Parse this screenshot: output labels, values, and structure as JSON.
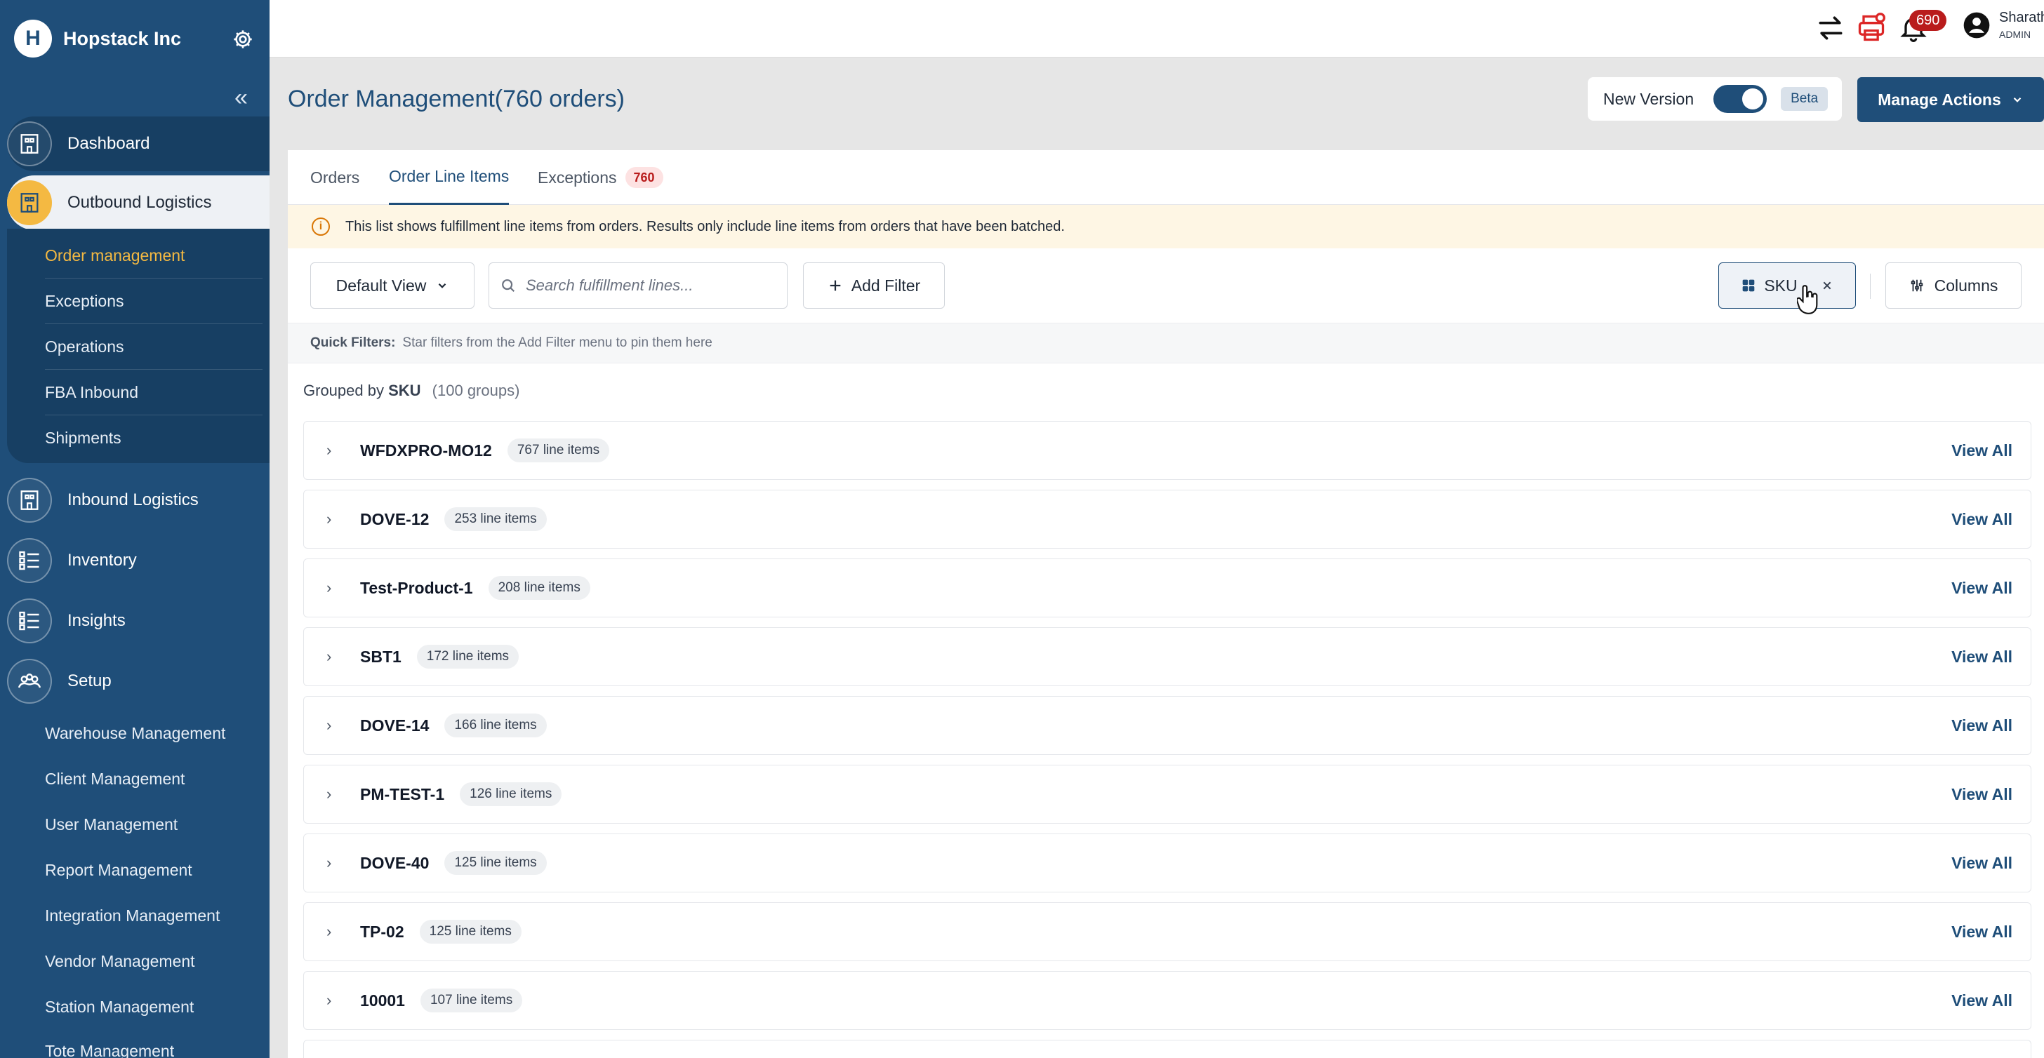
{
  "brand": {
    "name": "Hopstack Inc",
    "logo_letter": "H"
  },
  "sidebar": {
    "collapse_glyph": "«",
    "nav": [
      {
        "label": "Dashboard"
      },
      {
        "label": "Outbound Logistics"
      },
      {
        "label": "Inbound Logistics"
      },
      {
        "label": "Inventory"
      },
      {
        "label": "Insights"
      },
      {
        "label": "Setup"
      }
    ],
    "outbound_sub": [
      "Order management",
      "Exceptions",
      "Operations",
      "FBA Inbound",
      "Shipments"
    ],
    "setup_sub": [
      "Warehouse Management",
      "Client Management",
      "User Management",
      "Report Management",
      "Integration Management",
      "Vendor Management",
      "Station Management",
      "Tote Management"
    ]
  },
  "topbar": {
    "notification_count": "690",
    "user_name": "Sharath",
    "user_role": "ADMIN"
  },
  "header": {
    "title": "Order Management(760 orders)",
    "new_version_label": "New Version",
    "beta_label": "Beta",
    "manage_actions_label": "Manage Actions"
  },
  "tabs": [
    {
      "label": "Orders"
    },
    {
      "label": "Order Line Items"
    },
    {
      "label": "Exceptions",
      "count": "760"
    }
  ],
  "banner": {
    "icon": "i",
    "text": "This list shows fulfillment line items from orders. Results only include line items from orders that have been batched."
  },
  "toolbar": {
    "default_view_label": "Default View",
    "search_placeholder": "Search fulfillment lines...",
    "add_filter_label": "Add Filter",
    "sku_chip_label": "SKU",
    "columns_label": "Columns"
  },
  "quick_filters": {
    "label": "Quick Filters:",
    "hint": "Star filters from the Add Filter menu to pin them here"
  },
  "grouping": {
    "label": "Grouped by",
    "field": "SKU",
    "groups_text": "(100 groups)"
  },
  "groups": [
    {
      "sku": "WFDXPRO-MO12",
      "count": "767 line items"
    },
    {
      "sku": "DOVE-12",
      "count": "253 line items"
    },
    {
      "sku": "Test-Product-1",
      "count": "208 line items"
    },
    {
      "sku": "SBT1",
      "count": "172 line items"
    },
    {
      "sku": "DOVE-14",
      "count": "166 line items"
    },
    {
      "sku": "PM-TEST-1",
      "count": "126 line items"
    },
    {
      "sku": "DOVE-40",
      "count": "125 line items"
    },
    {
      "sku": "TP-02",
      "count": "125 line items"
    },
    {
      "sku": "10001",
      "count": "107 line items"
    }
  ],
  "view_all_label": "View All",
  "colors": {
    "primary": "#1f4e79",
    "accent": "#f4b942",
    "danger": "#b91c1c",
    "banner_bg": "#fef6e4"
  }
}
